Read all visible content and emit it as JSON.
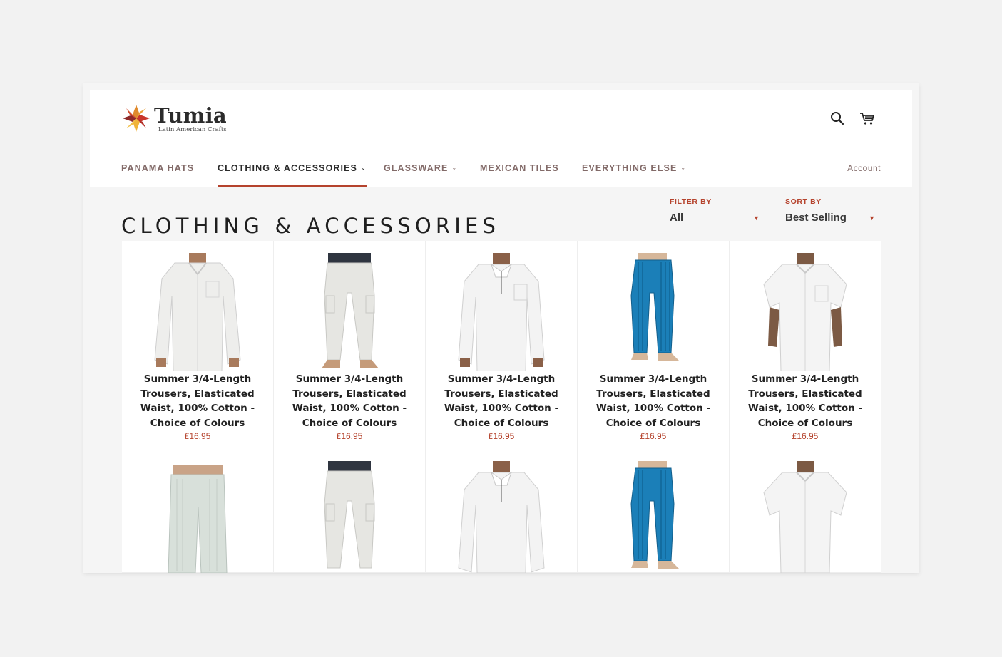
{
  "brand": {
    "name": "Tumia",
    "tagline": "Latin American Crafts"
  },
  "header": {
    "search_icon": "search-icon",
    "cart_icon": "cart-icon"
  },
  "nav": {
    "items": [
      {
        "label": "PANAMA HATS",
        "dropdown": false,
        "active": false
      },
      {
        "label": "CLOTHING & ACCESSORIES",
        "dropdown": true,
        "active": true
      },
      {
        "label": "GLASSWARE",
        "dropdown": true,
        "active": false
      },
      {
        "label": "MEXICAN TILES",
        "dropdown": false,
        "active": false
      },
      {
        "label": "EVERYTHING ELSE",
        "dropdown": true,
        "active": false
      }
    ],
    "account_label": "Account"
  },
  "collection": {
    "title": "CLOTHING & ACCESSORIES"
  },
  "filters": {
    "filter": {
      "label": "FILTER BY",
      "value": "All"
    },
    "sort": {
      "label": "SORT BY",
      "value": "Best Selling"
    }
  },
  "products": [
    {
      "name": "Summer 3/4-Length Trousers, Elasticated Waist, 100% Cotton - Choice of Colours",
      "price": "£16.95",
      "image": "white-long-sleeve-shirt"
    },
    {
      "name": "Summer 3/4-Length Trousers, Elasticated Waist, 100% Cotton - Choice of Colours",
      "price": "£16.95",
      "image": "white-cargo-trousers"
    },
    {
      "name": "Summer 3/4-Length Trousers, Elasticated Waist, 100% Cotton - Choice of Colours",
      "price": "£16.95",
      "image": "white-lace-up-shirt"
    },
    {
      "name": "Summer 3/4-Length Trousers, Elasticated Waist, 100% Cotton - Choice of Colours",
      "price": "£16.95",
      "image": "blue-striped-trousers"
    },
    {
      "name": "Summer 3/4-Length Trousers, Elasticated Waist, 100% Cotton - Choice of Colours",
      "price": "£16.95",
      "image": "white-short-sleeve-shirt"
    },
    {
      "name": "",
      "price": "",
      "image": "pale-green-trousers"
    },
    {
      "name": "",
      "price": "",
      "image": "white-cargo-trousers"
    },
    {
      "name": "",
      "price": "",
      "image": "white-lace-up-shirt"
    },
    {
      "name": "",
      "price": "",
      "image": "blue-striped-trousers"
    },
    {
      "name": "",
      "price": "",
      "image": "white-short-sleeve-shirt"
    }
  ],
  "colors": {
    "accent": "#b5432d",
    "nav_text": "#826a68",
    "text": "#222222",
    "background": "#f5f5f5"
  }
}
